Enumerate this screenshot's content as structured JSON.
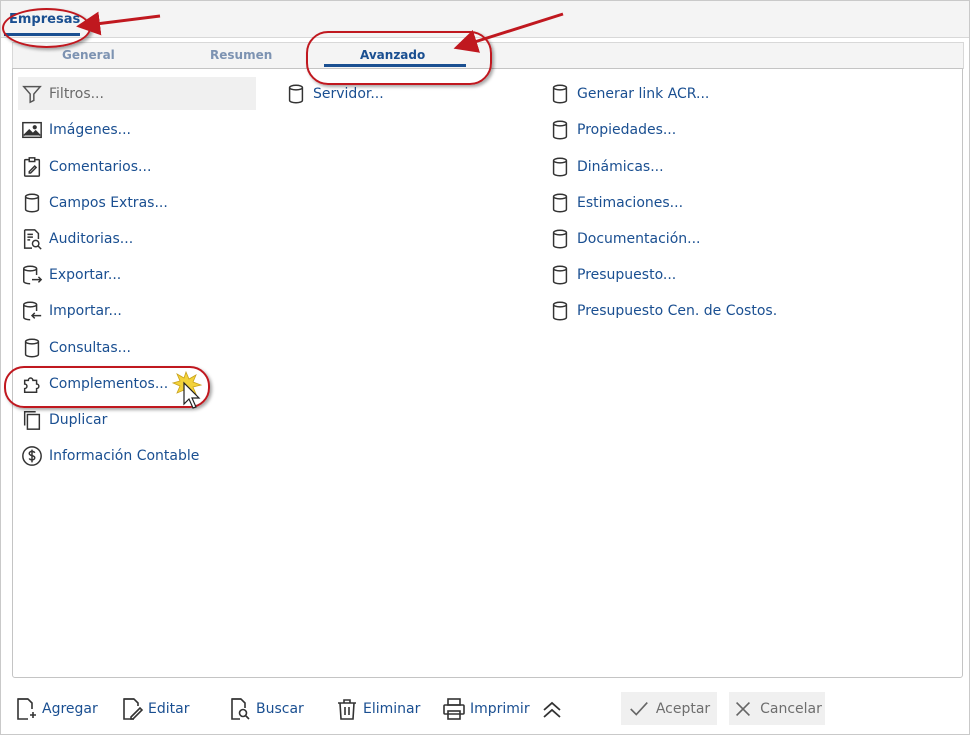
{
  "top_tab": {
    "label": "Empresas"
  },
  "sub_tabs": [
    {
      "label": "General",
      "active": false
    },
    {
      "label": "Resumen",
      "active": false
    },
    {
      "label": "Avanzado",
      "active": true
    }
  ],
  "col1": [
    {
      "label": "Filtros...",
      "icon": "filter-icon"
    },
    {
      "label": "Imágenes...",
      "icon": "image-icon"
    },
    {
      "label": "Comentarios...",
      "icon": "clipboard-edit-icon"
    },
    {
      "label": "Campos Extras...",
      "icon": "database-icon"
    },
    {
      "label": "Auditorias...",
      "icon": "document-search-icon"
    },
    {
      "label": "Exportar...",
      "icon": "database-export-icon"
    },
    {
      "label": "Importar...",
      "icon": "database-import-icon"
    },
    {
      "label": "Consultas...",
      "icon": "database-icon"
    },
    {
      "label": "Complementos...",
      "icon": "puzzle-icon"
    },
    {
      "label": "Duplicar",
      "icon": "copy-icon"
    },
    {
      "label": "Información Contable",
      "icon": "dollar-circle-icon"
    }
  ],
  "col2": [
    {
      "label": "Servidor...",
      "icon": "database-icon"
    }
  ],
  "col3": [
    {
      "label": "Generar link ACR...",
      "icon": "database-icon"
    },
    {
      "label": "Propiedades...",
      "icon": "database-icon"
    },
    {
      "label": "Dinámicas...",
      "icon": "database-icon"
    },
    {
      "label": "Estimaciones...",
      "icon": "database-icon"
    },
    {
      "label": "Documentación...",
      "icon": "database-icon"
    },
    {
      "label": "Presupuesto...",
      "icon": "database-icon"
    },
    {
      "label": "Presupuesto Cen. de Costos.",
      "icon": "database-icon"
    }
  ],
  "toolbar": {
    "add": "Agregar",
    "edit": "Editar",
    "search": "Buscar",
    "delete": "Eliminar",
    "print": "Imprimir",
    "accept": "Aceptar",
    "cancel": "Cancelar"
  },
  "colors": {
    "accent": "#1a4f91",
    "annotation": "#c0181f",
    "inactive_tab": "#7d93b2"
  }
}
